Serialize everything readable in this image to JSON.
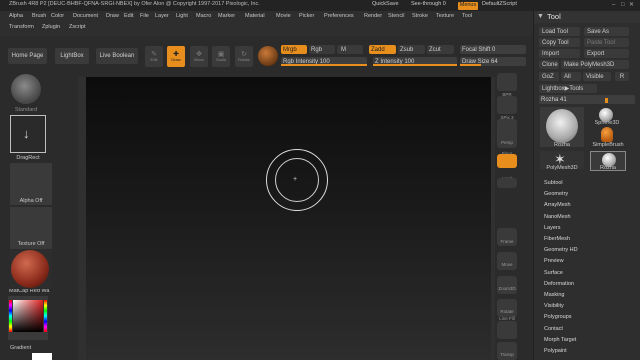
{
  "title_bar": {
    "title": "ZBrush 4R8 P2 [DEUC-BHBF-QFNA-SRGI-NBEX] by Ofer Alon @ Copyright 1997-2017 Pixologic, Inc.",
    "quicksave": "QuickSave",
    "see_through": "See-through  0",
    "menus": "Menus",
    "script": "DefaultZScript"
  },
  "menu_bar": {
    "row1": [
      "Alpha",
      "Brush",
      "Color",
      "Document",
      "Draw",
      "Edit",
      "File",
      "Layer",
      "Light",
      "Macro",
      "Marker",
      "Material",
      "Movie",
      "Picker",
      "Preferences",
      "Render",
      "Stencil",
      "Stroke",
      "Texture",
      "Tool"
    ],
    "row2": [
      "Transform",
      "Zplugin",
      "Zscript"
    ]
  },
  "top_shelf": {
    "home_page": "Home Page",
    "lightbox": "LightBox",
    "live_boolean": "Live Boolean",
    "edit": "Edit",
    "draw": "Draw",
    "move": "Move",
    "scale": "Scale",
    "rotate": "Rotate",
    "mrgb": "Mrgb",
    "rgb": "Rgb",
    "m": "M",
    "zadd": "Zadd",
    "zsub": "Zsub",
    "zcut": "Zcut",
    "focal_shift": "Focal Shift 0",
    "rgb_intensity": "Rgb Intensity 100",
    "z_intensity": "Z Intensity 100",
    "draw_size": "Draw Size 64"
  },
  "left_shelf": {
    "brush": "Standard",
    "stroke": "DragRect",
    "alpha": "Alpha Off",
    "texture": "Texture Off",
    "material": "MatCap Red Wa",
    "gradient": "Gradient"
  },
  "right_shelf": {
    "labels": [
      "BPR",
      "SPix 3",
      "",
      "Persp",
      "Floor",
      "Local",
      "Frame",
      "Move",
      "Zoom3D",
      "Rotate",
      "Line Fill",
      "Transp"
    ]
  },
  "tool_palette": {
    "title": "Tool",
    "load_tool": "Load Tool",
    "save_as": "Save As",
    "copy_tool": "Copy Tool",
    "paste_tool": "Paste Tool",
    "import": "Import",
    "export": "Export",
    "clone": "Clone",
    "make_polymesh": "Make PolyMesh3D",
    "goz": "GoZ",
    "all": "All",
    "visible": "Visible",
    "r": "R",
    "lightbox_tools": "Lightbox▶Tools",
    "current_tool": "Rozha 41",
    "thumbs": [
      {
        "name": "Rozha"
      },
      {
        "name": "Sphere3D"
      },
      {
        "name": "SimpleBrush"
      },
      {
        "name": "PolyMesh3D"
      },
      {
        "name": "Rozha"
      }
    ],
    "subpalettes": [
      "Subtool",
      "Geometry",
      "ArrayMesh",
      "NanoMesh",
      "Layers",
      "FiberMesh",
      "Geometry HD",
      "Preview",
      "Surface",
      "Deformation",
      "Masking",
      "Visibility",
      "Polygroups",
      "Contact",
      "Morph Target",
      "Polypaint"
    ]
  },
  "colors": {
    "accent": "#e88e1c",
    "background": "#2b2b2b"
  }
}
